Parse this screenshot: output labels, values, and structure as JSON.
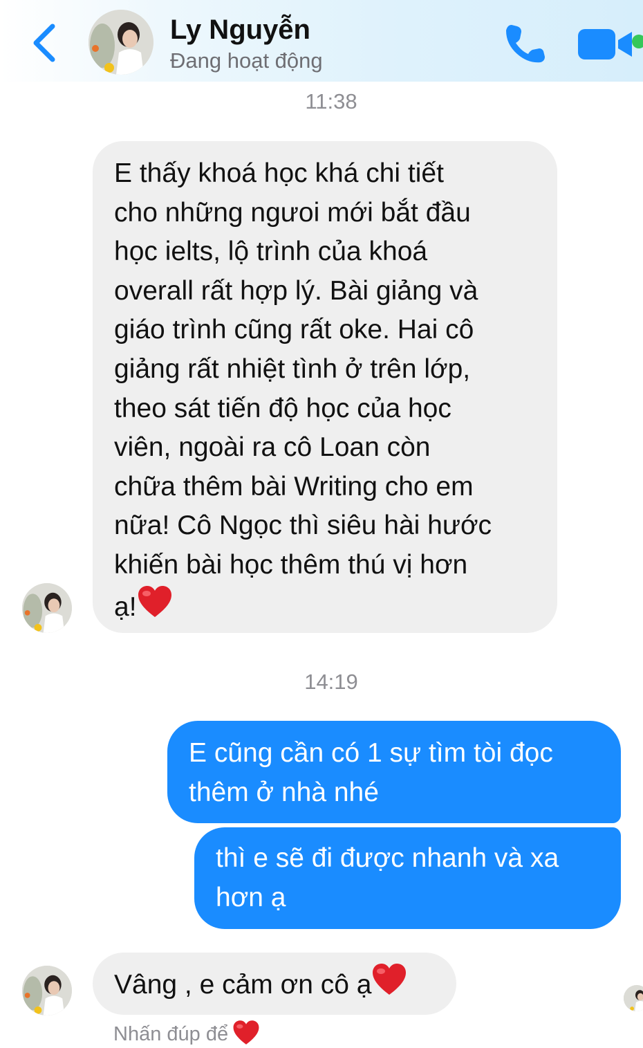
{
  "header": {
    "contact_name": "Ly Nguyễn",
    "status": "Đang hoạt động",
    "icons": {
      "back": "chevron-left-icon",
      "call": "phone-icon",
      "video": "video-camera-icon"
    },
    "accent_color": "#1a8cff",
    "active_color": "#35c75a"
  },
  "conversation": {
    "timestamps": [
      "11:38",
      "14:19"
    ],
    "messages": [
      {
        "direction": "incoming",
        "lines": [
          "E thấy khoá học khá chi tiết",
          "cho những ngưoi mới bắt đầu",
          "học ielts, lộ trình của khoá",
          "overall rất hợp lý. Bài giảng và",
          "giáo trình cũng rất oke. Hai cô",
          "giảng rất nhiệt tình ở trên lớp,",
          "theo sát tiến độ học của học",
          "viên, ngoài ra cô Loan còn",
          "chữa thêm bài Writing cho em",
          "nữa! Cô Ngọc thì siêu hài hước",
          "khiến bài học thêm thú vị hơn",
          "ạ!"
        ],
        "emoji": "heart-emoji",
        "color": "#efefef"
      },
      {
        "direction": "outgoing",
        "lines": [
          "E cũng cần có 1 sự tìm tòi đọc",
          "thêm ở nhà nhé"
        ],
        "color": "#1a8cff"
      },
      {
        "direction": "outgoing",
        "lines": [
          "thì e sẽ đi được nhanh và xa",
          "hơn ạ"
        ],
        "color": "#1a8cff"
      },
      {
        "direction": "incoming",
        "text": "Vâng , e cảm ơn cô ạ",
        "emoji": "heart-emoji",
        "color": "#efefef"
      }
    ],
    "hint_text": "Nhấn đúp để",
    "hint_emoji": "heart-emoji"
  }
}
